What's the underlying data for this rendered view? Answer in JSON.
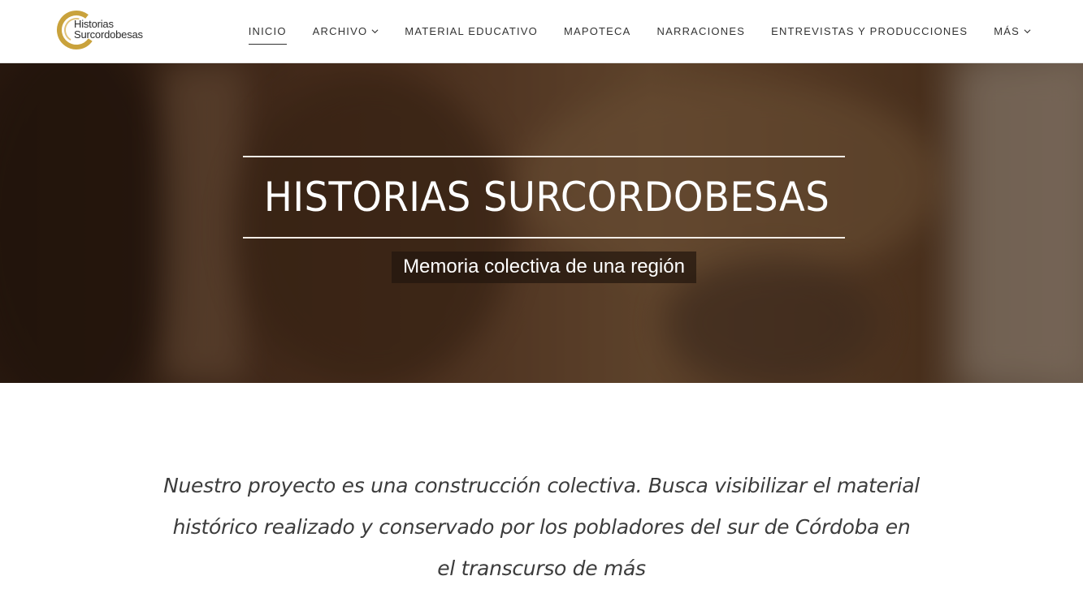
{
  "logo": {
    "line1": "Historias",
    "line2": "Surcordobesas",
    "color": "#c9a23c",
    "icon": "logo-emblem"
  },
  "nav": {
    "items": [
      {
        "label": "INICIO",
        "active": true,
        "dropdown": false
      },
      {
        "label": "ARCHIVO",
        "active": false,
        "dropdown": true
      },
      {
        "label": "MATERIAL EDUCATIVO",
        "active": false,
        "dropdown": false
      },
      {
        "label": "MAPOTECA",
        "active": false,
        "dropdown": false
      },
      {
        "label": "NARRACIONES",
        "active": false,
        "dropdown": false
      },
      {
        "label": "ENTREVISTAS Y PRODUCCIONES",
        "active": false,
        "dropdown": false
      },
      {
        "label": "MÁS",
        "active": false,
        "dropdown": true
      }
    ]
  },
  "hero": {
    "title": "HISTORIAS SURCORDOBESAS",
    "subtitle": "Memoria colectiva de una región"
  },
  "intro": {
    "text": "Nuestro proyecto es una construcción colectiva. Busca visibilizar el material histórico realizado y conservado por los pobladores del sur de Córdoba en el transcurso de más"
  },
  "colors": {
    "accent": "#c9a23c",
    "nav_text": "#333333",
    "intro_text": "#3c3c3c"
  }
}
